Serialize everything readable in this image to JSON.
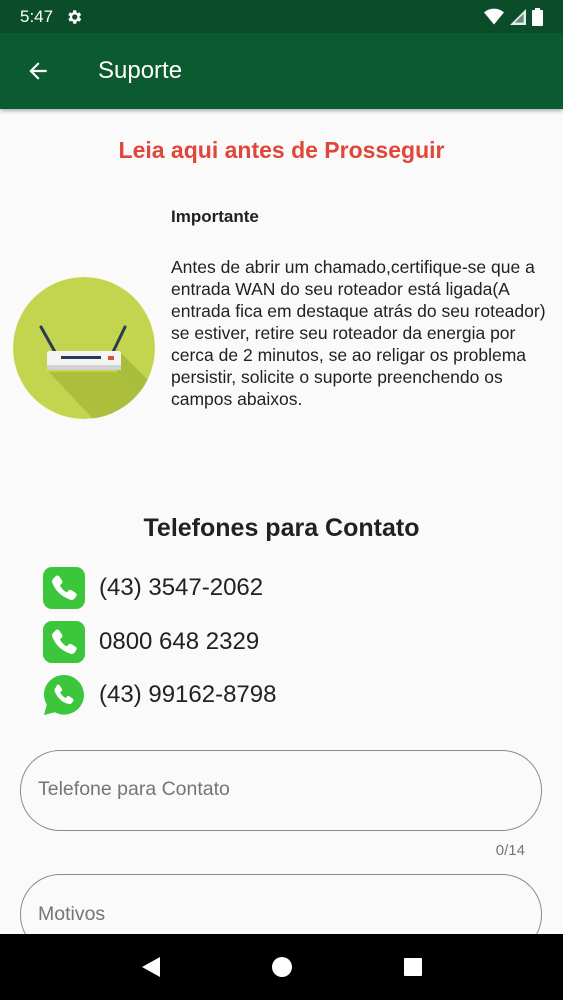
{
  "status_bar": {
    "time": "5:47",
    "icons": [
      "gear-icon",
      "wifi-icon",
      "signal-icon",
      "battery-icon"
    ]
  },
  "app_bar": {
    "title": "Suporte",
    "back_icon": "arrow-back-icon",
    "background_color": "#0b5a30"
  },
  "notice": {
    "title": "Leia aqui antes de Prosseguir",
    "title_color": "#e0463a",
    "important_label": "Importante",
    "important_text": "Antes de abrir um chamado,certifique-se que a entrada WAN do seu roteador está ligada(A entrada fica em destaque atrás do seu roteador) se estiver, retire seu roteador da energia por cerca de 2 minutos, se ao religar os problema persistir, solicite o suporte preenchendo os campos abaixos.",
    "image_icon": "router-icon"
  },
  "contacts": {
    "title": "Telefones para Contato",
    "phones": [
      {
        "number": "(43) 3547-2062",
        "icon": "phone-icon"
      },
      {
        "number": "0800 648 2329",
        "icon": "phone-icon"
      },
      {
        "number": "(43) 99162-8798",
        "icon": "whatsapp-icon"
      }
    ]
  },
  "form": {
    "phone_field": {
      "placeholder": "Telefone para Contato",
      "value": "",
      "counter": "0/14"
    },
    "reason_field": {
      "placeholder": "Motivos",
      "value": ""
    }
  },
  "nav_bar": {
    "icons": [
      "back-triangle-icon",
      "home-circle-icon",
      "recents-square-icon"
    ]
  }
}
